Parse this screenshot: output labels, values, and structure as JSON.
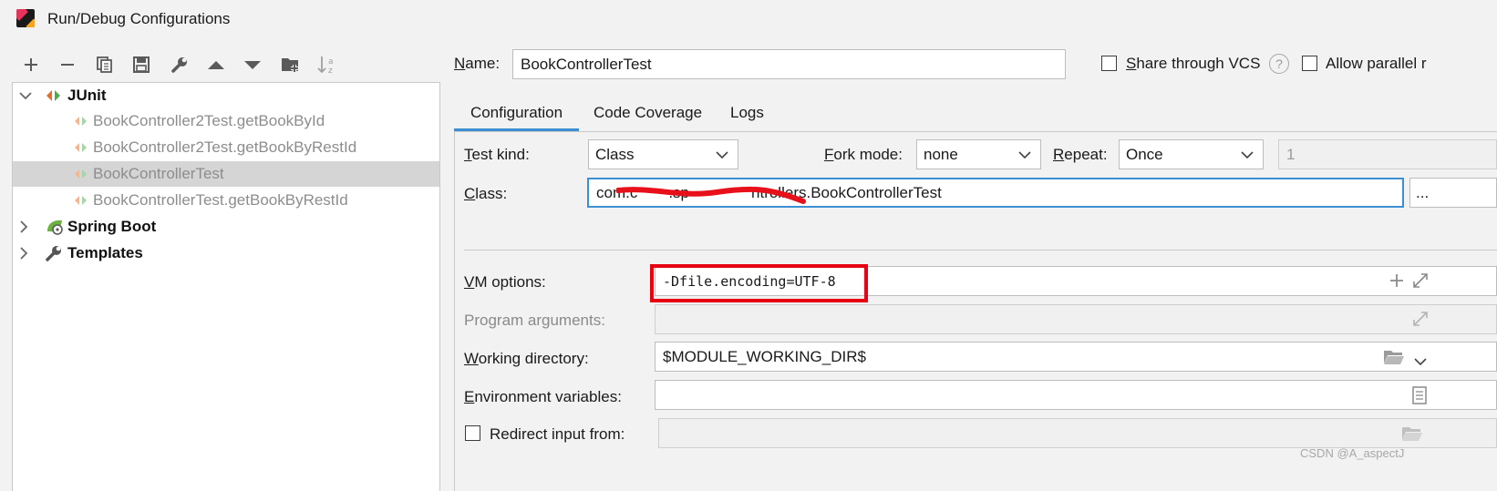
{
  "window": {
    "title": "Run/Debug Configurations"
  },
  "toolbar": {
    "icons": [
      "plus-icon",
      "minus-icon",
      "copy-icon",
      "save-icon",
      "wrench-icon",
      "arrow-up-icon",
      "arrow-down-icon",
      "folder-plus-icon",
      "sort-az-icon"
    ]
  },
  "tree": {
    "junit": {
      "label": "JUnit",
      "children": [
        "BookController2Test.getBookById",
        "BookController2Test.getBookByRestId",
        "BookControllerTest",
        "BookControllerTest.getBookByRestId"
      ],
      "selected_index": 2
    },
    "spring_boot": {
      "label": "Spring Boot"
    },
    "templates": {
      "label": "Templates"
    }
  },
  "form": {
    "name": {
      "label_u": "N",
      "label_rest": "ame:",
      "value": "BookControllerTest"
    },
    "share_vcs": {
      "label_u": "S",
      "label_rest": "hare through VCS",
      "checked": false
    },
    "help_glyph": "?",
    "allow_parallel": {
      "label": "Allow parallel r",
      "checked": false
    },
    "tabs": [
      "Configuration",
      "Code Coverage",
      "Logs"
    ],
    "active_tab": 0,
    "test_kind": {
      "label_u": "T",
      "label_rest": "est kind:",
      "value": "Class"
    },
    "fork_mode": {
      "label_u": "F",
      "label_rest": "ork mode:",
      "value": "none"
    },
    "repeat": {
      "label_u": "R",
      "label_rest": "epeat:",
      "value": "Once",
      "count": "1"
    },
    "class": {
      "label_u": "C",
      "label_rest": "lass:",
      "value": "com.c  .sp    ntrollers.BookControllerTest",
      "browse": "..."
    },
    "vm_options": {
      "label_u": "V",
      "label_rest": "M options:",
      "value": "-Dfile.encoding=UTF-8"
    },
    "program_arguments": {
      "label": "Program arguments:",
      "value": ""
    },
    "working_directory": {
      "label_u": "W",
      "label_rest": "orking directory:",
      "value": "$MODULE_WORKING_DIR$"
    },
    "environment_variables": {
      "label_u": "E",
      "label_rest": "nvironment variables:",
      "value": ""
    },
    "redirect_input": {
      "label": "Redirect input from:",
      "checked": false,
      "value": ""
    }
  },
  "watermark": "CSDN @A_aspectJ",
  "colors": {
    "tab_accent": "#3d8fd1",
    "highlight_box": "#e60012",
    "redaction": "#e8101a",
    "focus_border": "#3d8fd1"
  }
}
